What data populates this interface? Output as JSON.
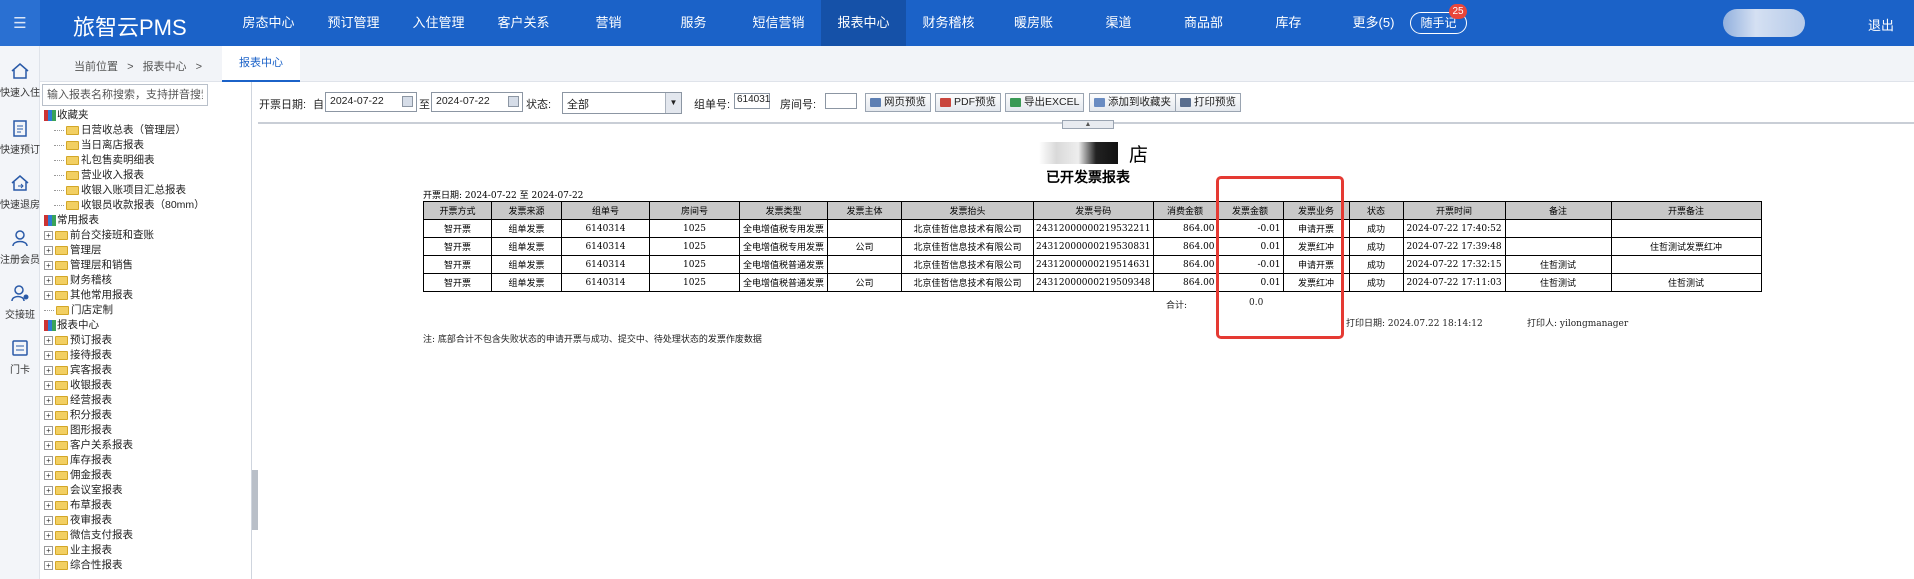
{
  "app": {
    "brand": "旅智云PMS",
    "logout": "退出"
  },
  "topnav": [
    {
      "label": "房态中心"
    },
    {
      "label": "预订管理"
    },
    {
      "label": "入住管理"
    },
    {
      "label": "客户关系"
    },
    {
      "label": "营销"
    },
    {
      "label": "服务"
    },
    {
      "label": "短信营销"
    },
    {
      "label": "报表中心"
    },
    {
      "label": "财务稽核"
    },
    {
      "label": "暖房账"
    },
    {
      "label": "渠道"
    },
    {
      "label": "商品部"
    },
    {
      "label": "库存"
    },
    {
      "label": "更多(5)"
    }
  ],
  "active_nav": "报表中心",
  "notes": {
    "label": "随手记",
    "badge": "25"
  },
  "rail": [
    {
      "label": "快速入住",
      "icon": "home-icon"
    },
    {
      "label": "快速预订",
      "icon": "clipboard-icon"
    },
    {
      "label": "快速退房",
      "icon": "checkout-icon"
    },
    {
      "label": "注册会员",
      "icon": "user-icon"
    },
    {
      "label": "交接班",
      "icon": "shift-icon"
    },
    {
      "label": "门卡",
      "icon": "card-icon"
    }
  ],
  "breadcrumb": {
    "prefix": "当前位置",
    "sep": ">",
    "crumb1": "报表中心",
    "sep2": ">",
    "tab": "报表中心"
  },
  "tree": {
    "search_placeholder": "输入报表名称搜索，支持拼音搜索",
    "nodes": [
      {
        "label": "收藏夹",
        "type": "root"
      },
      {
        "label": "日营收总表（管理层）",
        "type": "leaf"
      },
      {
        "label": "当日离店报表",
        "type": "leaf"
      },
      {
        "label": "礼包售卖明细表",
        "type": "leaf"
      },
      {
        "label": "营业收入报表",
        "type": "leaf"
      },
      {
        "label": "收银入账项目汇总报表",
        "type": "leaf"
      },
      {
        "label": "收银员收款报表（80mm）",
        "type": "leaf"
      },
      {
        "label": "常用报表",
        "type": "root"
      },
      {
        "label": "前台交接班和查账",
        "type": "folder"
      },
      {
        "label": "管理层",
        "type": "folder"
      },
      {
        "label": "管理层和销售",
        "type": "folder"
      },
      {
        "label": "财务稽核",
        "type": "folder"
      },
      {
        "label": "其他常用报表",
        "type": "folder"
      },
      {
        "label": "门店定制",
        "type": "folder-leaf"
      },
      {
        "label": "报表中心",
        "type": "root"
      },
      {
        "label": "预订报表",
        "type": "folder"
      },
      {
        "label": "接待报表",
        "type": "folder"
      },
      {
        "label": "宾客报表",
        "type": "folder"
      },
      {
        "label": "收银报表",
        "type": "folder"
      },
      {
        "label": "经营报表",
        "type": "folder"
      },
      {
        "label": "积分报表",
        "type": "folder"
      },
      {
        "label": "图形报表",
        "type": "folder"
      },
      {
        "label": "客户关系报表",
        "type": "folder"
      },
      {
        "label": "库存报表",
        "type": "folder"
      },
      {
        "label": "佣金报表",
        "type": "folder"
      },
      {
        "label": "会议室报表",
        "type": "folder"
      },
      {
        "label": "布草报表",
        "type": "folder"
      },
      {
        "label": "夜审报表",
        "type": "folder"
      },
      {
        "label": "微信支付报表",
        "type": "folder"
      },
      {
        "label": "业主报表",
        "type": "folder"
      },
      {
        "label": "综合性报表",
        "type": "folder"
      }
    ]
  },
  "toolbar": {
    "date_label": "开票日期:",
    "from_label": "自",
    "date_from": "2024-07-22",
    "to_label": "至",
    "date_to": "2024-07-22",
    "status_label": "状态:",
    "status_value": "全部",
    "group_label": "组单号:",
    "group_value": "614031",
    "room_label": "房间号:",
    "room_value": "",
    "btn_web": "网页预览",
    "btn_pdf": "PDF预览",
    "btn_excel": "导出EXCEL",
    "btn_fav": "添加到收藏夹",
    "btn_print": "打印预览"
  },
  "report": {
    "hotel_suffix": "店",
    "title": "已开发票报表",
    "date_range": "开票日期: 2024-07-22 至 2024-07-22",
    "columns": [
      "开票方式",
      "发票来源",
      "组单号",
      "房间号",
      "发票类型",
      "发票主体",
      "发票抬头",
      "发票号码",
      "消费金额",
      "发票金额",
      "发票业务",
      "状态",
      "开票时间",
      "备注",
      "开票备注"
    ],
    "rows": [
      [
        "智开票",
        "组单发票",
        "6140314",
        "1025",
        "全电增值税专用发票",
        "",
        "北京佳哲信息技术有限公司",
        "24312000000219532211",
        "864.00",
        "-0.01",
        "申请开票",
        "成功",
        "2024-07-22 17:40:52",
        "",
        ""
      ],
      [
        "智开票",
        "组单发票",
        "6140314",
        "1025",
        "全电增值税专用发票",
        "公司",
        "北京佳哲信息技术有限公司",
        "24312000000219530831",
        "864.00",
        "0.01",
        "发票红冲",
        "成功",
        "2024-07-22 17:39:48",
        "",
        "住哲测试发票红冲"
      ],
      [
        "智开票",
        "组单发票",
        "6140314",
        "1025",
        "全电增值税普通发票",
        "",
        "北京佳哲信息技术有限公司",
        "24312000000219514631",
        "864.00",
        "-0.01",
        "申请开票",
        "成功",
        "2024-07-22 17:32:15",
        "住哲测试",
        ""
      ],
      [
        "智开票",
        "组单发票",
        "6140314",
        "1025",
        "全电增值税普通发票",
        "公司",
        "北京佳哲信息技术有限公司",
        "24312000000219509348",
        "864.00",
        "0.01",
        "发票红冲",
        "成功",
        "2024-07-22 17:11:03",
        "住哲测试",
        "住哲测试"
      ]
    ],
    "total_label": "合计:",
    "total_value": "0.0",
    "print_date": "打印日期: 2024.07.22 18:14:12",
    "printer": "打印人: yilongmanager",
    "footnote": "注: 底部合计不包含失败状态的申请开票与成功、提交中、待处理状态的发票作废数据"
  },
  "colors": {
    "topbar": "#1b62c8",
    "highlight": "#e53a33"
  }
}
